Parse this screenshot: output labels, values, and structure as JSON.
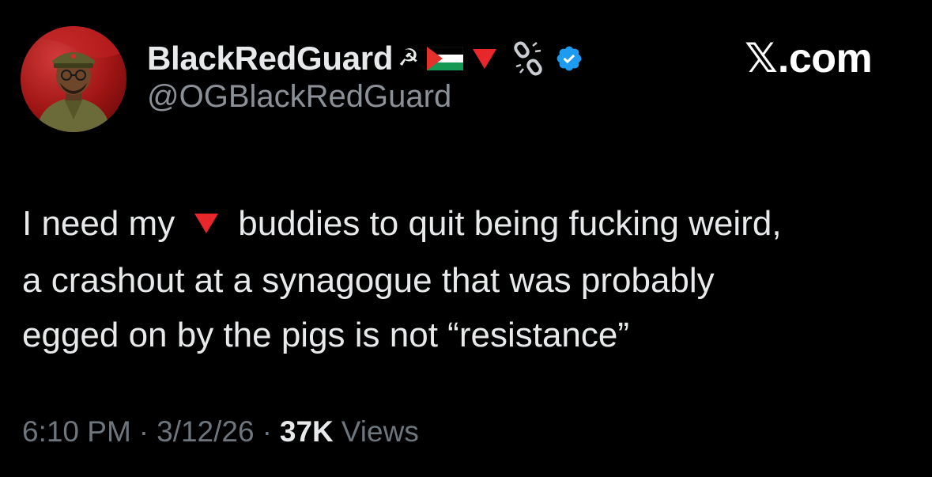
{
  "author": {
    "display_name": "BlackRedGuard",
    "handle": "@OGBlackRedGuard",
    "name_badges": {
      "sickle": "☭",
      "flag_icon": "palestine-flag-icon",
      "triangle_icon": "red-triangle-icon",
      "chain_icon": "broken-chain-icon",
      "verified_icon": "verified-badge-icon"
    },
    "verified_color": "#1d9bf0"
  },
  "brand": {
    "logo": "𝕏",
    "domain": ".com"
  },
  "tweet": {
    "line1_before": "I need my",
    "line1_after": "buddies to quit being fucking weird,",
    "line2": "a crashout at a synagogue that was probably",
    "line3": "egged on by the pigs is not “resistance”",
    "inline_icon": "red-triangle-icon"
  },
  "meta": {
    "time": "6:10 PM",
    "separator": "·",
    "date": "3/12/26",
    "views_count": "37K",
    "views_label": "Views"
  },
  "colors": {
    "background": "#000000",
    "text_primary": "#e7e9ea",
    "text_secondary": "#8b9097",
    "accent_red": "#e8272b"
  }
}
